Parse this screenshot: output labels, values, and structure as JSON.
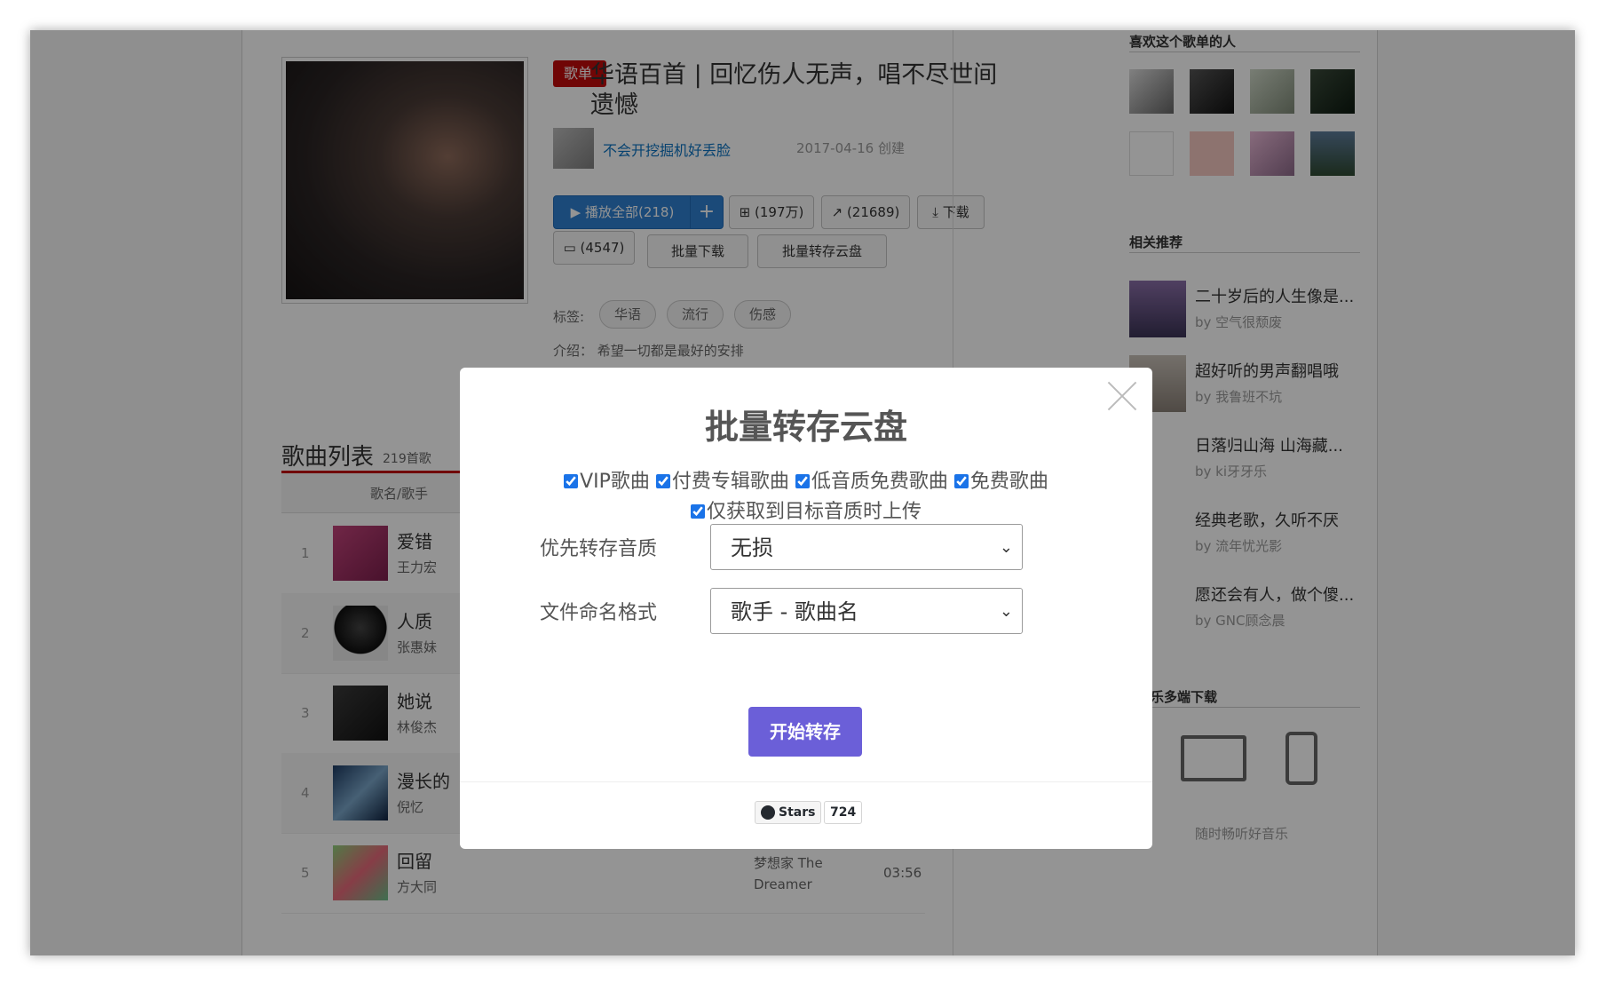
{
  "playlist": {
    "badge": "歌单",
    "title_line1": "华语百首 | 回忆伤人无声，唱不尽世间",
    "title_line2": "遗憾",
    "creator": "不会开挖掘机好丢脸",
    "created": "2017-04-16 创建",
    "buttons": {
      "play": "播放全部(218)",
      "add": "+",
      "collect": "(197万)",
      "share": "(21689)",
      "download": "下载",
      "comment": "(4547)",
      "batch_download": "批量下载",
      "batch_save": "批量转存云盘"
    },
    "tags_label": "标签:",
    "tags": [
      "华语",
      "流行",
      "伤感"
    ],
    "intro": "介绍： 希望一切都是最好的安排"
  },
  "song_list": {
    "title": "歌曲列表",
    "count": "219首歌",
    "header": "歌名/歌手",
    "rows": [
      {
        "num": "1",
        "name": "爱错",
        "artist": "王力宏",
        "album": "",
        "duration": ""
      },
      {
        "num": "2",
        "name": "人质",
        "artist": "张惠妹",
        "album": "",
        "duration": ""
      },
      {
        "num": "3",
        "name": "她说",
        "artist": "林俊杰",
        "album": "",
        "duration": ""
      },
      {
        "num": "4",
        "name": "漫长的",
        "artist": "倪忆",
        "album": "",
        "duration": ""
      },
      {
        "num": "5",
        "name": "回留",
        "artist": "方大同",
        "album": "梦想家 The Dreamer",
        "duration": "03:56"
      }
    ]
  },
  "sidebar": {
    "likers_title": "喜欢这个歌单的人",
    "related_title": "相关推荐",
    "related": [
      {
        "title": "二十岁后的人生像是...",
        "by": "by 空气很颓废"
      },
      {
        "title": "超好听的男声翻唱哦",
        "by": "by 我鲁班不坑"
      },
      {
        "title": "日落归山海 山海藏...",
        "by": "by ki牙牙乐"
      },
      {
        "title": "经典老歌，久听不厌",
        "by": "by 流年忧光影"
      },
      {
        "title": "愿还会有人，做个傻...",
        "by": "by GNC顾念晨"
      }
    ],
    "download_title": "乐多端下载",
    "download_note": "随时畅听好音乐"
  },
  "modal": {
    "title": "批量转存云盘",
    "options": [
      "VIP歌曲",
      "付费专辑歌曲",
      "低音质免费歌曲",
      "免费歌曲"
    ],
    "option_extra": "仅获取到目标音质时上传",
    "quality_label": "优先转存音质",
    "quality_value": "无损",
    "naming_label": "文件命名格式",
    "naming_value": "歌手 - 歌曲名",
    "start_button": "开始转存",
    "github_stars_label": "Stars",
    "github_stars_count": "724"
  }
}
